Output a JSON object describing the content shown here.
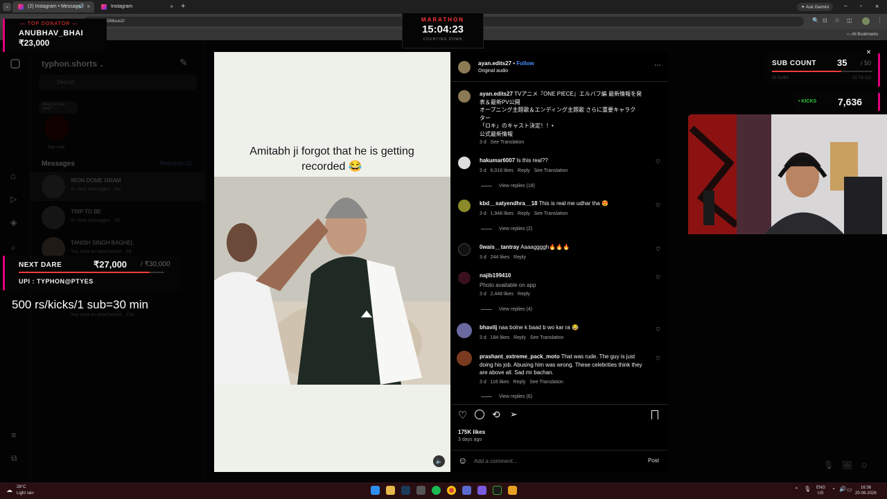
{
  "browser": {
    "tabs": [
      {
        "title": "(2) Instagram • Messages"
      },
      {
        "title": "Instagram"
      }
    ],
    "new_tab": "+",
    "url": "/GMsus2/",
    "ask_gemini": "Ask Gemini",
    "all_bookmarks": "All Bookmarks"
  },
  "overlay": {
    "top_donator_label": "TOP DONATOR",
    "top_donator_name": "ANUBHAV_BHAI",
    "top_donator_amount": "₹23,000",
    "marathon_label": "MARATHON",
    "marathon_timer": "15:04:23",
    "marathon_sub": "COUNTING DOWN",
    "sub_count_label": "SUB COUNT",
    "sub_count": "35",
    "sub_goal": "/ 50",
    "sub_row_a": "35 SUBS",
    "sub_row_b": "15 TO GO",
    "kicks_label": "• KICKS",
    "kicks_value": "7,636",
    "next_dare_label": "NEXT DARE",
    "next_dare_amount": "₹27,000",
    "next_dare_goal": "/ ₹30,000",
    "upi": "UPI : TYPHON@PTYES",
    "rate_text": "500 rs/kicks/1 sub=30 min"
  },
  "sidebar": {
    "account": "typhon.shorts",
    "search_placeholder": "Search",
    "note_bubble": "What's on your mind?",
    "note_label": "Your note",
    "messages_label": "Messages",
    "requests_label": "Requests (2)",
    "threads": [
      {
        "name": "IRON DOME GRAM",
        "preview": "4+ new messages",
        "time": "5m"
      },
      {
        "name": "TRIP TO BE",
        "preview": "4+ new messages",
        "time": "2d"
      },
      {
        "name": "TANISH SINGH BAGHEL",
        "preview": "You sent an attachment",
        "time": "3d"
      },
      {
        "name": "",
        "preview": "You sent an attachment",
        "time": "11w"
      }
    ]
  },
  "video": {
    "caption": "Amitabh ji forgot that he is getting recorded 😂"
  },
  "post": {
    "author": "ayan.edits27",
    "follow": "Follow",
    "audio": "Original audio",
    "caption_author": "ayan.edits27",
    "caption_lines": [
      "TVアニメ『ONE PIECE』エルバフ編 最新情報を発",
      "表＆最新PV公開",
      "オープニング主題歌＆エンディング主題歌 さらに重要キャラク",
      "ター",
      "「ロキ」のキャスト決定！！•",
      "公式最新情報"
    ],
    "caption_time": "3 d",
    "see_translation": "See Translation",
    "comments": [
      {
        "user": "hakumar6007",
        "text": "Is this real??",
        "time": "3 d",
        "likes": "6,016 likes",
        "reply": "Reply",
        "translate": "See Translation",
        "view_replies": "View replies (18)"
      },
      {
        "user": "kbd__satyendhra__18",
        "text": "This is real me udhar tha 😍",
        "time": "3 d",
        "likes": "1,948 likes",
        "reply": "Reply",
        "translate": "See Translation",
        "view_replies": "View replies (2)"
      },
      {
        "user": "0wais__tantray",
        "text": "Aaaaggggh🔥🔥🔥",
        "time": "3 d",
        "likes": "244 likes",
        "reply": "Reply",
        "translate": "",
        "view_replies": ""
      },
      {
        "user": "najib199410",
        "text": "Photo available on app",
        "time": "3 d",
        "likes": "2,448 likes",
        "reply": "Reply",
        "translate": "",
        "view_replies": "View replies (4)"
      },
      {
        "user": "bhavilj",
        "text": "naa bolne k baad b wo kar ra 😂",
        "time": "3 d",
        "likes": "184 likes",
        "reply": "Reply",
        "translate": "See Translation",
        "view_replies": ""
      },
      {
        "user": "prashant_extreme_pack_moto",
        "text": "That was rude. The guy is just doing his job. Abusing him was wrong. These celebrities think they are above all. Sad mr bachan.",
        "time": "3 d",
        "likes": "116 likes",
        "reply": "Reply",
        "translate": "See Translation",
        "view_replies": "View replies (6)"
      }
    ],
    "likes": "175K likes",
    "date": "3 days ago",
    "add_comment_placeholder": "Add a comment...",
    "post_button": "Post"
  },
  "taskbar": {
    "temp": "28°C",
    "weather": "Light rain",
    "lang": "ENG",
    "region": "US",
    "time": "16:36",
    "date": "20-08-2026"
  }
}
